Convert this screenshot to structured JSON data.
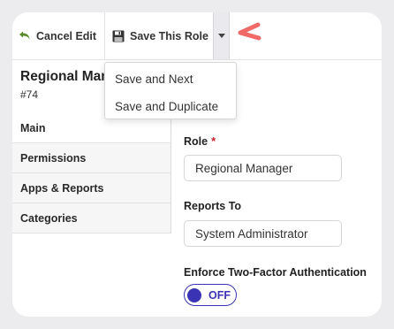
{
  "toolbar": {
    "cancel_label": "Cancel Edit",
    "save_label": "Save This Role",
    "cancel_icon": "undo-arrow-icon",
    "save_icon": "floppy-disk-icon"
  },
  "dropdown": {
    "items": [
      {
        "label": "Save and Next"
      },
      {
        "label": "Save and Duplicate"
      }
    ]
  },
  "header": {
    "title": "Regional Manager",
    "id": "#74"
  },
  "tabs": [
    {
      "label": "Main",
      "active": true
    },
    {
      "label": "Permissions",
      "active": false
    },
    {
      "label": "Apps & Reports",
      "active": false
    },
    {
      "label": "Categories",
      "active": false
    }
  ],
  "form": {
    "role": {
      "label": "Role",
      "required_mark": "*",
      "value": "Regional Manager"
    },
    "reports_to": {
      "label": "Reports To",
      "value": "System Administrator"
    },
    "two_factor": {
      "label": "Enforce Two-Factor Authentication",
      "state": "OFF"
    }
  },
  "colors": {
    "accent": "#3a34b5",
    "annotation": "#f06a6a",
    "required": "#c3262e"
  }
}
